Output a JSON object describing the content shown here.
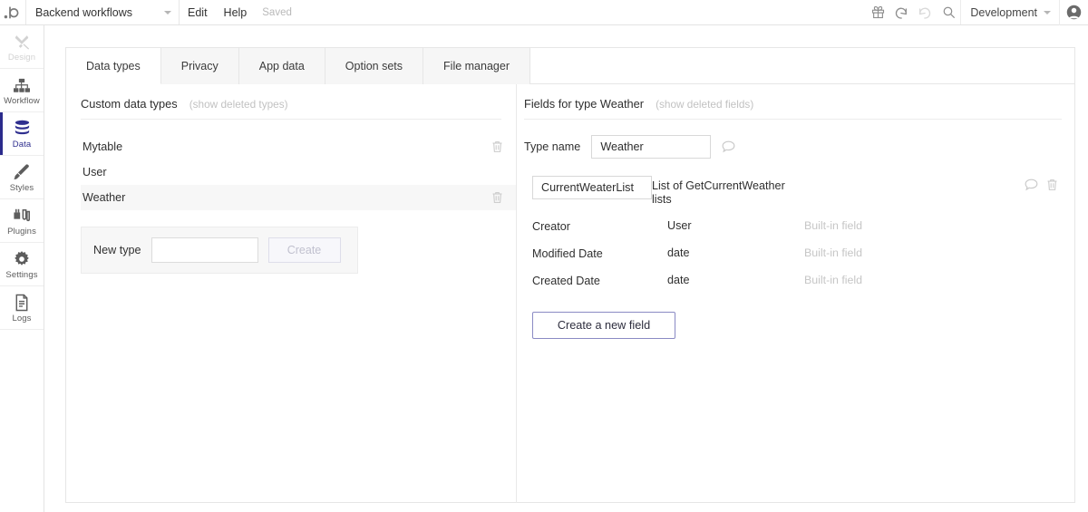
{
  "topbar": {
    "logo": "bubble-logo",
    "app_name": "Backend workflows",
    "edit_label": "Edit",
    "help_label": "Help",
    "save_status": "Saved",
    "gift_icon": "gift-icon",
    "undo_icon": "undo-icon",
    "redo_icon": "redo-icon",
    "search_icon": "search-icon",
    "version_label": "Development",
    "avatar_icon": "user-avatar-icon"
  },
  "sidebar": {
    "items": [
      {
        "label": "Design",
        "icon": "design-icon",
        "state": "disabled"
      },
      {
        "label": "Workflow",
        "icon": "workflow-icon",
        "state": "normal"
      },
      {
        "label": "Data",
        "icon": "data-icon",
        "state": "active"
      },
      {
        "label": "Styles",
        "icon": "styles-icon",
        "state": "normal"
      },
      {
        "label": "Plugins",
        "icon": "plugins-icon",
        "state": "normal"
      },
      {
        "label": "Settings",
        "icon": "settings-icon",
        "state": "normal"
      },
      {
        "label": "Logs",
        "icon": "logs-icon",
        "state": "normal"
      }
    ]
  },
  "tabs": [
    {
      "label": "Data types",
      "active": true
    },
    {
      "label": "Privacy",
      "active": false
    },
    {
      "label": "App data",
      "active": false
    },
    {
      "label": "Option sets",
      "active": false
    },
    {
      "label": "File manager",
      "active": false
    }
  ],
  "left_panel": {
    "title": "Custom data types",
    "show_deleted_link": "(show deleted types)",
    "types": [
      {
        "name": "Mytable",
        "selected": false,
        "deletable": true
      },
      {
        "name": "User",
        "selected": false,
        "deletable": false
      },
      {
        "name": "Weather",
        "selected": true,
        "deletable": true
      }
    ],
    "new_type": {
      "label": "New type",
      "value": "",
      "placeholder": "",
      "create_label": "Create"
    }
  },
  "right_panel": {
    "title": "Fields for type Weather",
    "show_deleted_link": "(show deleted fields)",
    "type_name": {
      "label": "Type name",
      "value": "Weather"
    },
    "fields": [
      {
        "name": "CurrentWeaterList",
        "editable": true,
        "type": "List of GetCurrentWeather lists",
        "note": "",
        "icons": true
      },
      {
        "name": "Creator",
        "editable": false,
        "type": "User",
        "note": "Built-in field",
        "icons": false
      },
      {
        "name": "Modified Date",
        "editable": false,
        "type": "date",
        "note": "Built-in field",
        "icons": false
      },
      {
        "name": "Created Date",
        "editable": false,
        "type": "date",
        "note": "Built-in field",
        "icons": false
      }
    ],
    "create_field_label": "Create a new field"
  },
  "colors": {
    "accent": "#2b2b8c",
    "button_border": "#8a8ac4",
    "panel_border": "#e6e6e6",
    "muted_text": "#c2c2c2",
    "row_selected_bg": "#f7f7f7"
  }
}
